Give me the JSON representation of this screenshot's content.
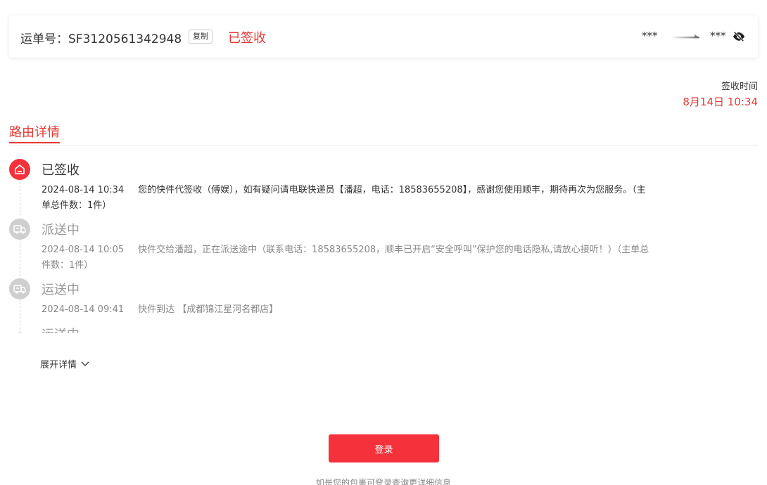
{
  "header": {
    "waybill_label": "运单号：SF3120561342948",
    "copy_label": "复制",
    "status": "已签收",
    "route_from": "***",
    "route_to": "***",
    "eye_icon": "eye-slash-icon"
  },
  "sign": {
    "label": "签收时间",
    "time": "8月14日 10:34"
  },
  "tab": {
    "title": "路由详情"
  },
  "timeline": [
    {
      "status": "已签收",
      "time": "2024-08-14 10:34",
      "text": "您的快件代签收（傅娱），如有疑问请电联快递员【潘超，电话：18583655208】，感谢您使用顺丰，期待再次为您服务。（主单总件数：1件）",
      "icon": "signed-home-icon",
      "active": true
    },
    {
      "status": "派送中",
      "time": "2024-08-14 10:05",
      "text": "快件交给潘超，正在派送途中（联系电话：18583655208，顺丰已开启“安全呼叫”保护您的电话隐私,请放心接听！）（主单总件数：1件）",
      "icon": "truck-icon",
      "active": false
    },
    {
      "status": "运送中",
      "time": "2024-08-14 09:41",
      "text": "快件到达 【成都锦江星河名都店】",
      "icon": "truck-icon",
      "active": false
    },
    {
      "status": "运送中",
      "time": "",
      "text": "",
      "icon": "dot-icon",
      "active": false
    }
  ],
  "expand_label": "展开详情",
  "login_label": "登录",
  "hint": "如是您的包裹可登录查询更详细信息",
  "colors": {
    "accent": "#f5323c",
    "status_red": "#e53935",
    "gray_icon": "#cfcfcf"
  }
}
